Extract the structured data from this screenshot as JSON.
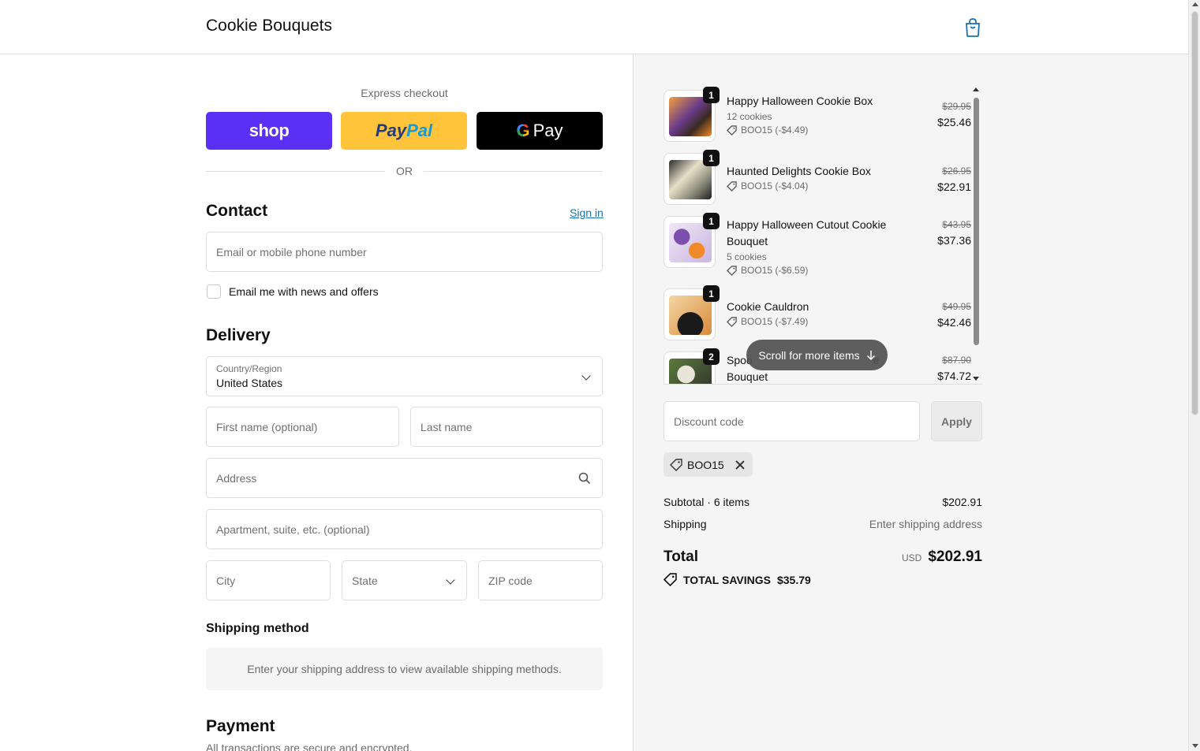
{
  "header": {
    "brand": "Cookie Bouquets"
  },
  "express": {
    "title": "Express checkout",
    "shop_label": "shop",
    "paypal_label_1": "Pay",
    "paypal_label_2": "Pal",
    "gpay_g": "G",
    "gpay_label": "Pay",
    "or_text": "OR"
  },
  "contact": {
    "heading": "Contact",
    "signin": "Sign in",
    "email_placeholder": "Email or mobile phone number",
    "news_label": "Email me with news and offers"
  },
  "delivery": {
    "heading": "Delivery",
    "country_label": "Country/Region",
    "country_value": "United States",
    "first_name": "First name (optional)",
    "last_name": "Last name",
    "address": "Address",
    "apartment": "Apartment, suite, etc. (optional)",
    "city": "City",
    "state": "State",
    "zip": "ZIP code"
  },
  "shipping_method": {
    "heading": "Shipping method",
    "message": "Enter your shipping address to view available shipping methods."
  },
  "payment": {
    "heading": "Payment",
    "subtitle": "All transactions are secure and encrypted."
  },
  "cart": {
    "items": [
      {
        "qty": "1",
        "name": "Happy Halloween Cookie Box",
        "variant": "12 cookies",
        "discount": "BOO15 (-$4.49)",
        "old_price": "$29.95",
        "price": "$25.46"
      },
      {
        "qty": "1",
        "name": "Haunted Delights Cookie Box",
        "variant": "",
        "discount": "BOO15 (-$4.04)",
        "old_price": "$26.95",
        "price": "$22.91"
      },
      {
        "qty": "1",
        "name": "Happy Halloween Cutout Cookie Bouquet",
        "variant": "5 cookies",
        "discount": "BOO15 (-$6.59)",
        "old_price": "$43.95",
        "price": "$37.36"
      },
      {
        "qty": "1",
        "name": "Cookie Cauldron",
        "variant": "",
        "discount": "BOO15 (-$7.49)",
        "old_price": "$49.95",
        "price": "$42.46"
      },
      {
        "qty": "2",
        "name": "Spooky Cookie Bouquet",
        "name_line1": "Spoo",
        "name_line1_tail": "e",
        "name_line2": "Bouquet",
        "variant": "",
        "discount": "",
        "old_price": "$87.90",
        "price": "$74.72"
      }
    ],
    "scroll_hint": "Scroll for more items"
  },
  "discount": {
    "placeholder": "Discount code",
    "apply": "Apply",
    "applied_code": "BOO15"
  },
  "summary": {
    "subtotal_label": "Subtotal · 6 items",
    "subtotal_value": "$202.91",
    "shipping_label": "Shipping",
    "shipping_value": "Enter shipping address",
    "total_label": "Total",
    "currency": "USD",
    "total_value": "$202.91",
    "savings_label": "TOTAL SAVINGS",
    "savings_value": "$35.79"
  },
  "colors": {
    "shop": "#5a31f4",
    "paypal": "#ffc439",
    "gpay": "#000000",
    "link": "#1773b0"
  }
}
